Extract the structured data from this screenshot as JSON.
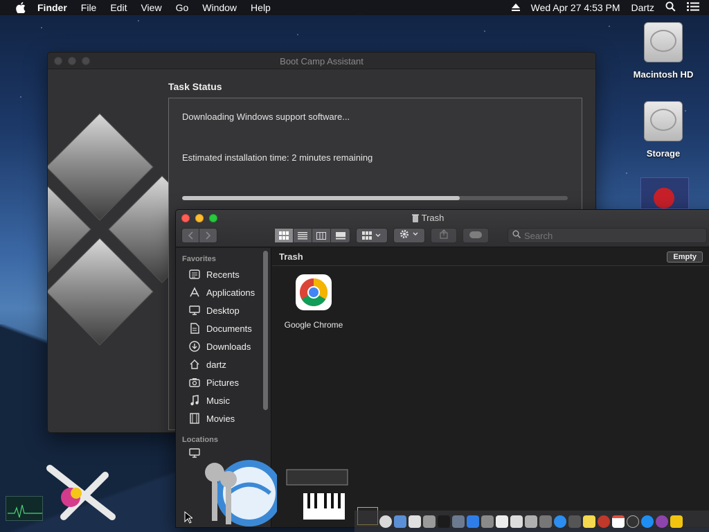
{
  "menubar": {
    "app_name": "Finder",
    "items": [
      "File",
      "Edit",
      "View",
      "Go",
      "Window",
      "Help"
    ],
    "clock": "Wed Apr 27  4:53 PM",
    "user": "Dartz"
  },
  "desktop": {
    "icons": [
      {
        "label": "Macintosh HD"
      },
      {
        "label": "Storage"
      }
    ]
  },
  "bootcamp": {
    "title": "Boot Camp Assistant",
    "task_title": "Task Status",
    "status_message": "Downloading Windows support software...",
    "time_message": "Estimated installation time: 2 minutes remaining",
    "progress_fraction": 0.72
  },
  "finder": {
    "title": "Trash",
    "search_placeholder": "Search",
    "sidebar": {
      "favorites_label": "Favorites",
      "favorites": [
        {
          "label": "Recents",
          "icon": "recents-icon"
        },
        {
          "label": "Applications",
          "icon": "applications-icon"
        },
        {
          "label": "Desktop",
          "icon": "desktop-icon"
        },
        {
          "label": "Documents",
          "icon": "documents-icon"
        },
        {
          "label": "Downloads",
          "icon": "downloads-icon"
        },
        {
          "label": "dartz",
          "icon": "home-icon"
        },
        {
          "label": "Pictures",
          "icon": "pictures-icon"
        },
        {
          "label": "Music",
          "icon": "music-icon"
        },
        {
          "label": "Movies",
          "icon": "movies-icon"
        }
      ],
      "locations_label": "Locations"
    },
    "content": {
      "header": "Trash",
      "empty_button": "Empty",
      "files": [
        {
          "label": "Google Chrome",
          "icon": "chrome-icon"
        }
      ]
    }
  },
  "colors": {
    "accent_red": "#ff5f57",
    "accent_yellow": "#febc2e",
    "accent_green": "#28c840",
    "window_bg": "#1e1e1e"
  }
}
